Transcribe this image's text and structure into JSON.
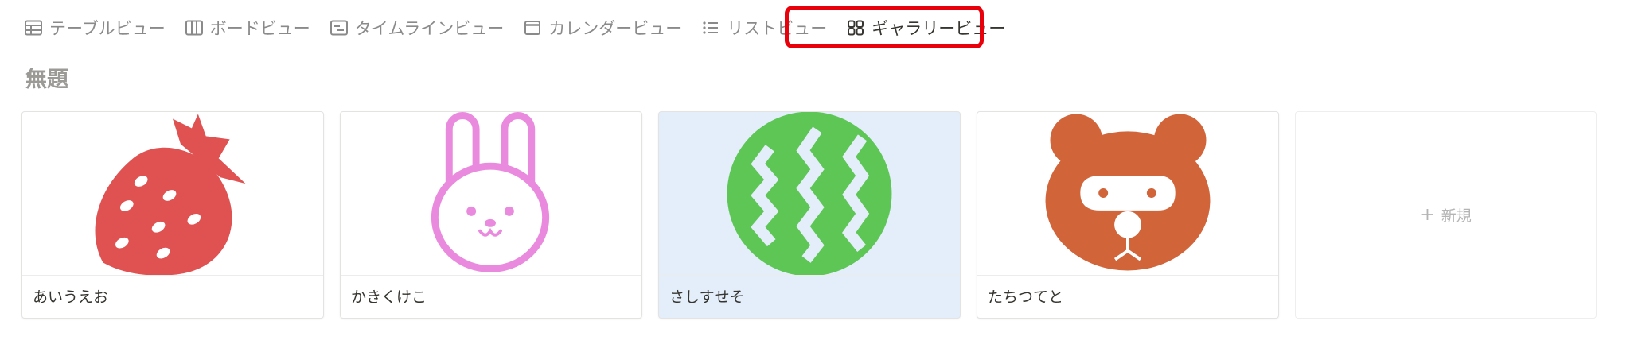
{
  "tabs": [
    {
      "label": "テーブルビュー",
      "icon": "table-icon",
      "active": false
    },
    {
      "label": "ボードビュー",
      "icon": "board-icon",
      "active": false
    },
    {
      "label": "タイムラインビュー",
      "icon": "timeline-icon",
      "active": false
    },
    {
      "label": "カレンダービュー",
      "icon": "calendar-icon",
      "active": false
    },
    {
      "label": "リストビュー",
      "icon": "list-icon",
      "active": false
    },
    {
      "label": "ギャラリービュー",
      "icon": "gallery-icon",
      "active": true
    }
  ],
  "page": {
    "title": "無題"
  },
  "cards": [
    {
      "title": "あいうえお",
      "cover": "strawberry-icon",
      "color": "#e05252",
      "selected": false
    },
    {
      "title": "かきくけこ",
      "cover": "rabbit-icon",
      "color": "#ea8ade",
      "selected": false
    },
    {
      "title": "さしすせそ",
      "cover": "watermelon-icon",
      "color": "#5ec655",
      "selected": true
    },
    {
      "title": "たちつてと",
      "cover": "bear-icon",
      "color": "#d2643a",
      "selected": false
    }
  ],
  "new_card": {
    "label": "新規"
  },
  "colors": {
    "highlight_outline": "#e8000b",
    "selected_card_bg": "#e3eefa"
  }
}
